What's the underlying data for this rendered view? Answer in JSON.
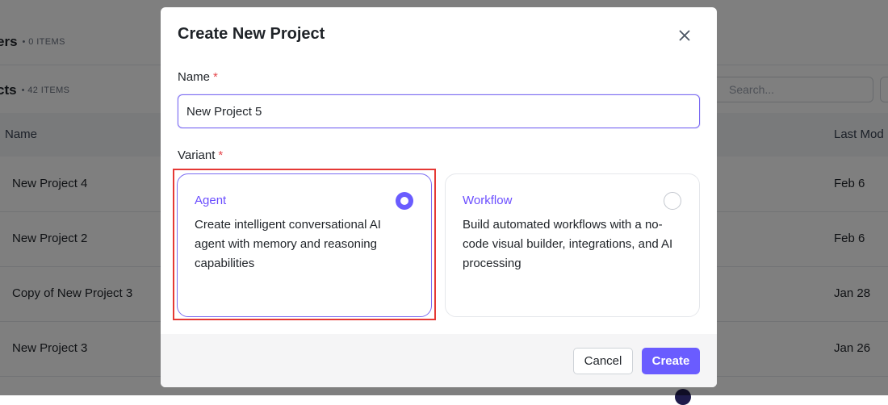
{
  "background": {
    "sections": [
      {
        "title": "Folders",
        "visible_title": "ers",
        "count": "• 0 ITEMS"
      },
      {
        "title": "Projects",
        "visible_title": "cts",
        "count": "• 42 ITEMS"
      }
    ],
    "search_placeholder": "Search...",
    "columns": {
      "name": "Name",
      "last_modified": "Last Mod"
    },
    "rows": [
      {
        "name": "New Project 4",
        "date": "Feb 6"
      },
      {
        "name": "New Project 2",
        "date": "Feb 6"
      },
      {
        "name": "Copy of New Project 3",
        "date": "Jan 28"
      },
      {
        "name": "New Project 3",
        "date": "Jan 26"
      }
    ]
  },
  "modal": {
    "title": "Create New Project",
    "close_icon": "close-icon",
    "name_label": "Name",
    "required_mark": "*",
    "name_value": "New Project 5",
    "variant_label": "Variant",
    "variants": [
      {
        "title": "Agent",
        "description": "Create intelligent conversational AI agent with memory and reasoning capabilities",
        "selected": true
      },
      {
        "title": "Workflow",
        "description": "Build automated workflows with a no-code visual builder, integrations, and AI processing",
        "selected": false
      }
    ],
    "cancel_label": "Cancel",
    "create_label": "Create"
  },
  "colors": {
    "accent": "#6a5cff",
    "required": "#e5484d",
    "highlight": "#e53935"
  }
}
